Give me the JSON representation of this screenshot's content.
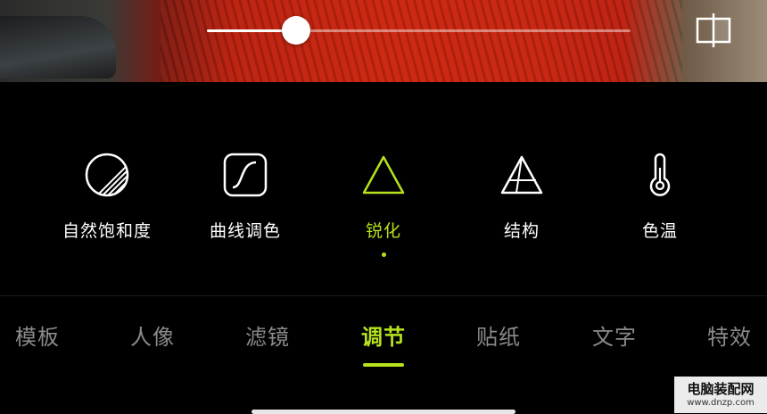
{
  "preview": {
    "slider_value": 0.21
  },
  "tools": [
    {
      "label": "自然饱和度",
      "icon": "vibrance-icon"
    },
    {
      "label": "曲线调色",
      "icon": "curves-icon"
    },
    {
      "label": "锐化",
      "icon": "sharpen-icon",
      "active": true
    },
    {
      "label": "结构",
      "icon": "structure-icon"
    },
    {
      "label": "色温",
      "icon": "thermometer-icon"
    }
  ],
  "tabs": [
    {
      "label": "模板"
    },
    {
      "label": "人像"
    },
    {
      "label": "滤镜"
    },
    {
      "label": "调节",
      "active": true
    },
    {
      "label": "贴纸"
    },
    {
      "label": "文字"
    },
    {
      "label": "特效"
    }
  ],
  "watermark": {
    "title": "电脑装配网",
    "url": "www.dnzp.com"
  },
  "colors": {
    "accent": "#b6e21d",
    "inactive_tab": "#8a8a8a",
    "background": "#000000"
  }
}
